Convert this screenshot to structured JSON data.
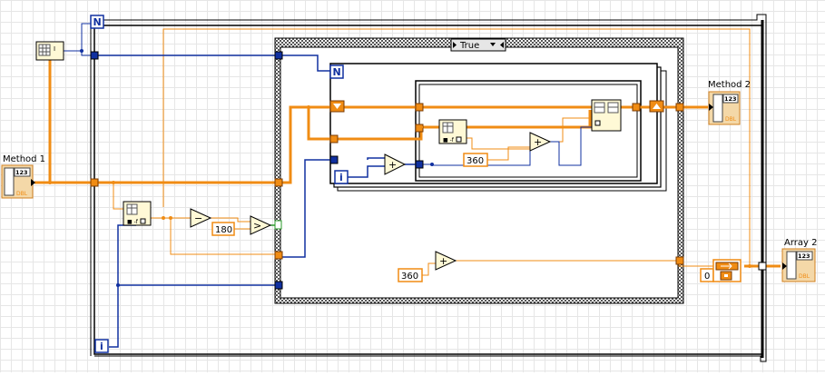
{
  "diagram": {
    "case_selector": "True",
    "count_terminal": "N",
    "iteration_terminal": "i",
    "controls": {
      "method1": {
        "label": "Method 1",
        "type_badge": "123",
        "repr": "DBL"
      },
      "method2": {
        "label": "Method 2",
        "type_badge": "123",
        "repr": "DBL"
      },
      "array2": {
        "label": "Array 2",
        "type_badge": "123",
        "repr": "DBL"
      }
    },
    "constants": {
      "c180": "180",
      "c360_inner": "360",
      "c360_outer": "360",
      "c0": "0"
    },
    "operators": {
      "minus": "−",
      "greater": ">",
      "plus": "+"
    },
    "colors": {
      "dbl_wire": "#f08c14",
      "int_wire": "#1030a0",
      "bool_wire": "#2a9a2a",
      "structure_frame": "#000000"
    }
  }
}
